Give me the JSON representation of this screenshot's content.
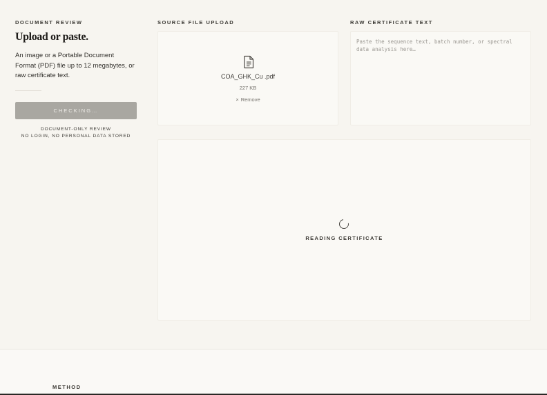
{
  "left": {
    "eyebrow": "DOCUMENT REVIEW",
    "title": "Upload or paste.",
    "description": "An image or a Portable Document Format (PDF) file up to 12 megabytes, or raw certificate text.",
    "button_label": "CHECKING…",
    "note_line1": "DOCUMENT-ONLY REVIEW",
    "note_line2": "NO LOGIN, NO PERSONAL DATA STORED"
  },
  "upload": {
    "eyebrow": "SOURCE FILE UPLOAD",
    "file_icon": "file-document-icon",
    "file_name": "COA_GHK_Cu .pdf",
    "file_size": "227 KB",
    "remove_label": "Remove",
    "remove_icon": "×"
  },
  "raw": {
    "eyebrow": "RAW CERTIFICATE TEXT",
    "value": "",
    "placeholder": "Paste the sequence text, batch number, or spectral data analysis here…"
  },
  "reader": {
    "status": "READING CERTIFICATE"
  },
  "bottom": {
    "section_label": "METHOD"
  },
  "colors": {
    "background": "#f7f5f0",
    "panel": "#faf9f5",
    "button_disabled": "#a9a7a1",
    "text": "#2e2c29"
  }
}
